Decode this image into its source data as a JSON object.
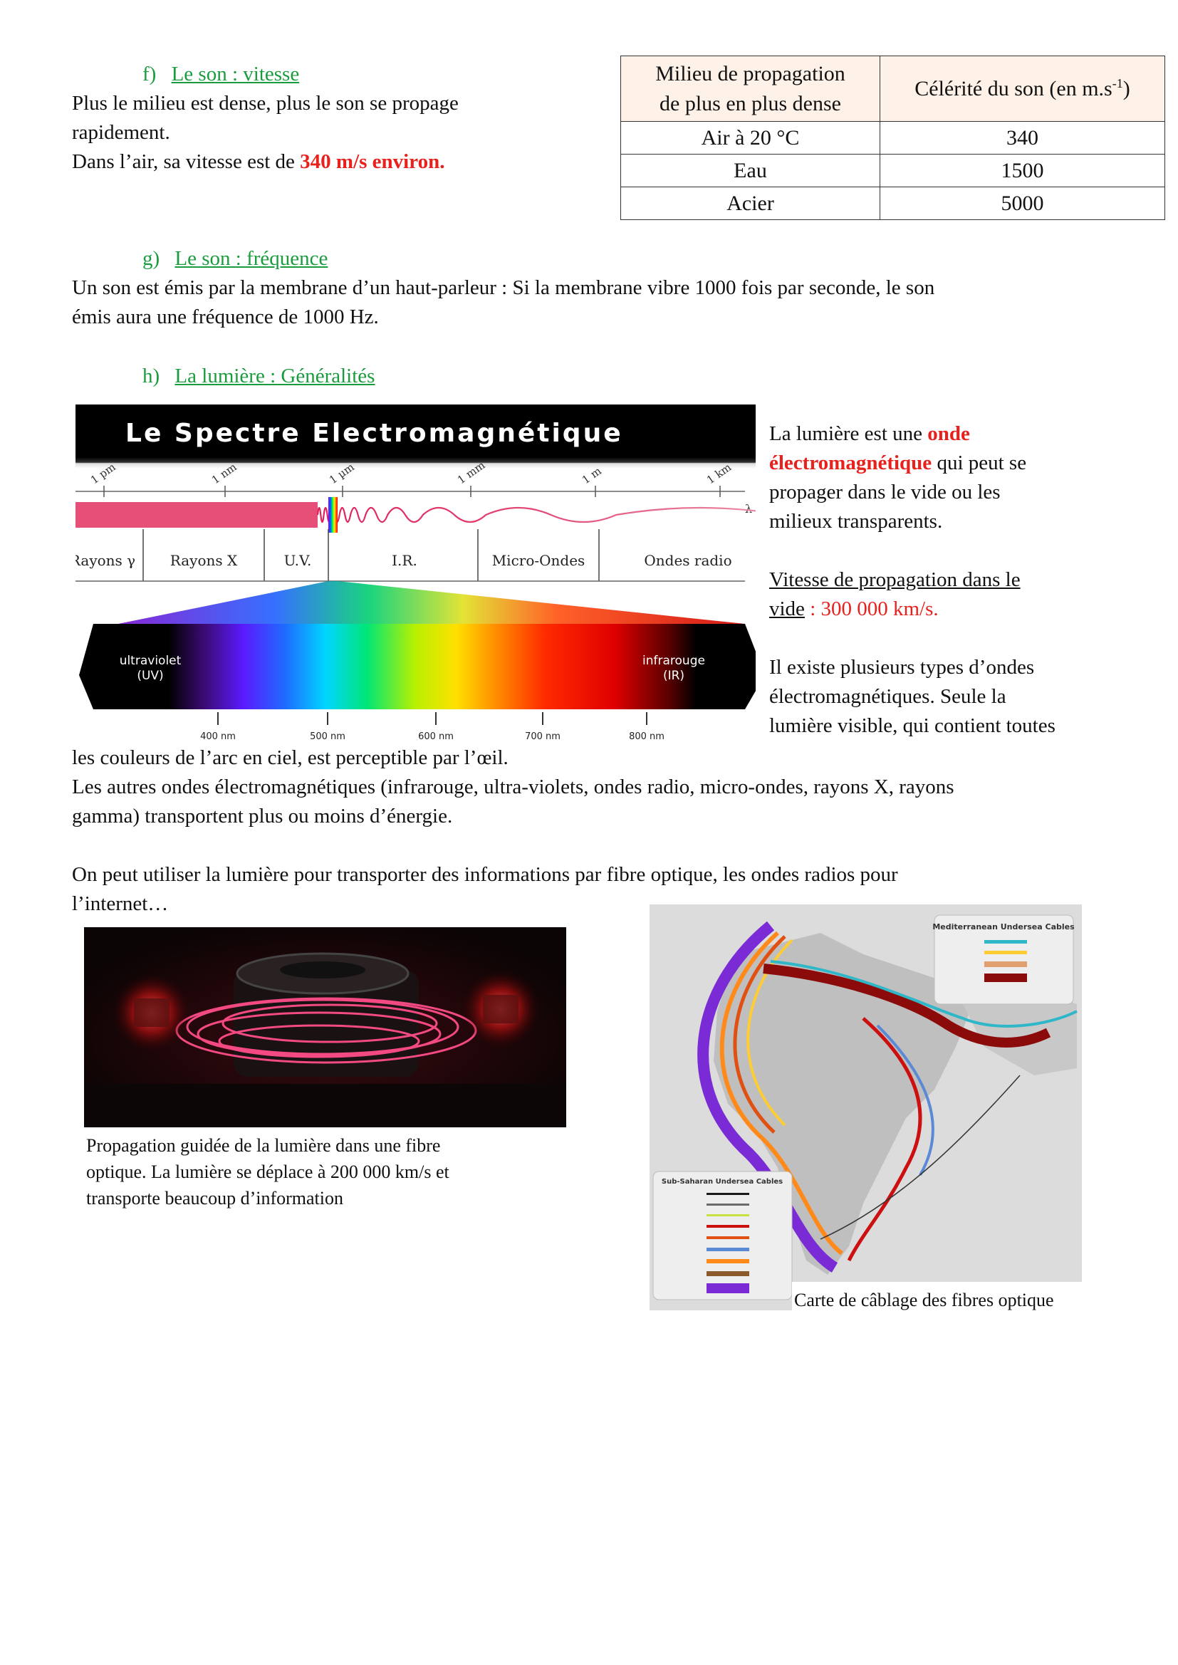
{
  "section_f": {
    "marker": "f)",
    "title": "Le son : vitesse",
    "line1": "Plus le milieu est dense, plus le son se propage",
    "line2": "rapidement.",
    "line3_prefix": "Dans l’air, sa vitesse est de ",
    "line3_highlight": "340 m/s environ."
  },
  "speed_table": {
    "header_col1_line1": "Milieu de propagation",
    "header_col1_line2": "de plus en plus dense",
    "header_col2": "Célérité du son (en m.s",
    "header_col2_sup": "-1",
    "header_col2_end": ")",
    "rows": [
      {
        "medium": "Air à 20 °C",
        "speed": "340"
      },
      {
        "medium": "Eau",
        "speed": "1500"
      },
      {
        "medium": "Acier",
        "speed": "5000"
      }
    ]
  },
  "section_g": {
    "marker": "g)",
    "title": "Le son : fréquence",
    "line1": "Un son est émis par la membrane d’un haut-parleur : Si la membrane vibre 1000 fois par seconde, le son",
    "line2": "émis aura une fréquence de 1000 Hz."
  },
  "section_h": {
    "marker": "h)",
    "title": "La lumière : Généralités",
    "r1_prefix": "La lumière est une ",
    "r1_red": "onde",
    "r2_red": "électromagnétique",
    "r2_suffix": " qui peut se",
    "r3": "propager dans le vide ou les",
    "r4": "milieux transparents.",
    "r5_ul": "Vitesse de propagation dans le",
    "r6_ul": "vide",
    "r6_red": " : 300 000 km/s.",
    "r7": "Il existe plusieurs types d’ondes",
    "r8": "électromagnétiques. Seule la",
    "r9": "lumière visible, qui contient toutes",
    "p_full1": "les couleurs de l’arc en ciel, est perceptible par l’œil.",
    "p_full2": "Les autres ondes électromagnétiques (infrarouge, ultra-violets, ondes radio, micro-ondes, rayons X, rayons",
    "p_full3": "gamma) transportent plus ou moins d’énergie.",
    "p_full4": "On peut utiliser la lumière pour transporter des informations par fibre optique, les ondes radios pour",
    "p_full5": "l’internet…"
  },
  "spectrum": {
    "title": "Le Spectre Electromagnétique",
    "scale": [
      "1 pm",
      "1 nm",
      "1 µm",
      "1 mm",
      "1 m",
      "1 km"
    ],
    "lambda": "λ",
    "bands": [
      "Rayons γ",
      "Rayons X",
      "U.V.",
      "I.R.",
      "Micro-Ondes",
      "Ondes radio"
    ],
    "uv_label1": "ultraviolet",
    "uv_label2": "(UV)",
    "ir_label1": "infrarouge",
    "ir_label2": "(IR)",
    "nm_ticks": [
      "400 nm",
      "500 nm",
      "600 nm",
      "700 nm",
      "800 nm"
    ]
  },
  "fiber_caption": {
    "line1": "Propagation guidée de la lumière dans une fibre",
    "line2": "optique. La lumière se déplace à 200 000 km/s et",
    "line3": "transporte beaucoup d’information"
  },
  "map": {
    "med_title": "Mediterranean Undersea Cables",
    "ssa_title": "Sub-Saharan Undersea Cables",
    "caption": "Carte de câblage des fibres optique"
  },
  "colors": {
    "heading_green": "#1a9c3e",
    "highlight_red": "#e8211d",
    "table_header_bg": "#fdf1e8"
  }
}
